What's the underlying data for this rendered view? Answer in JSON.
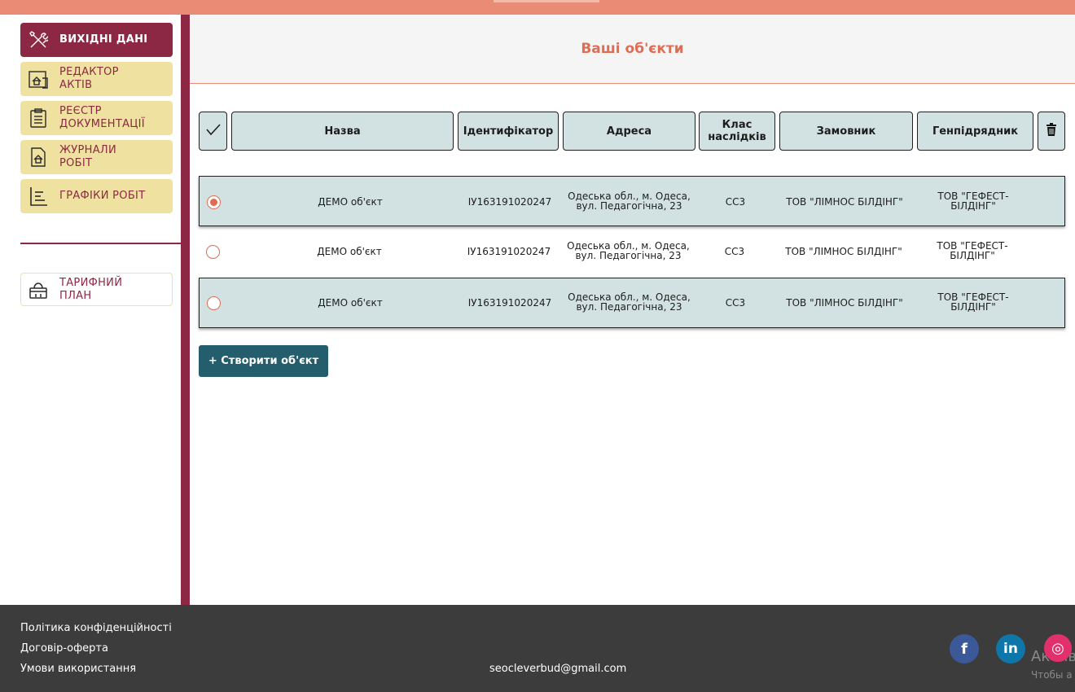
{
  "colors": {
    "accent": "#8c2844",
    "topbar": "#e98b75",
    "title": "#e06c52",
    "nav_bg": "#efe2a0",
    "table_bg": "#d2e2e2",
    "button": "#245d6b",
    "footer": "#3c3c3c"
  },
  "sidebar": {
    "items": [
      {
        "label": "ВИХІДНІ ДАНІ",
        "icon": "tools-icon",
        "active": true
      },
      {
        "label": "РЕДАКТОР АКТІВ",
        "icon": "house-document-icon",
        "active": false
      },
      {
        "label": "РЕЄСТР ДОКУМЕНТАЦІЇ",
        "icon": "clipboard-icon",
        "active": false
      },
      {
        "label": "ЖУРНАЛИ РОБІТ",
        "icon": "house-file-icon",
        "active": false
      },
      {
        "label": "ГРАФІКИ РОБІТ",
        "icon": "chart-lines-icon",
        "active": false
      }
    ],
    "tariff": {
      "label": "ТАРИФНИЙ ПЛАН",
      "icon": "basket-icon"
    }
  },
  "main": {
    "title": "Ваші об'єкти",
    "columns": [
      "Назва",
      "Ідентифікатор",
      "Адреса",
      "Клас наслідків",
      "Замовник",
      "Генпідрядник"
    ],
    "select_all_icon": "checkmark-icon",
    "delete_icon": "trash-icon",
    "rows": [
      {
        "selected": true,
        "name": "ДЕМО об'єкт",
        "id": "ІУ163191020247",
        "address": "Одеська обл., м. Одеса, вул. Педагогічна, 23",
        "class": "СС3",
        "customer": "ТОВ \"ЛІМНОС БІЛДІНГ\"",
        "contractor": "ТОВ \"ГЕФЕСТ-БІЛДІНГ\""
      },
      {
        "selected": false,
        "name": "ДЕМО об'єкт",
        "id": "ІУ163191020247",
        "address": "Одеська обл., м. Одеса, вул. Педагогічна, 23",
        "class": "СС3",
        "customer": "ТОВ \"ЛІМНОС БІЛДІНГ\"",
        "contractor": "ТОВ \"ГЕФЕСТ-БІЛДІНГ\""
      },
      {
        "selected": false,
        "name": "ДЕМО об'єкт",
        "id": "ІУ163191020247",
        "address": "Одеська обл., м. Одеса, вул. Педагогічна, 23",
        "class": "СС3",
        "customer": "ТОВ \"ЛІМНОС БІЛДІНГ\"",
        "contractor": "ТОВ \"ГЕФЕСТ-БІЛДІНГ\""
      }
    ],
    "create_button": "+ Створити об'єкт"
  },
  "footer": {
    "links": [
      "Політика конфіденційності",
      "Договір-оферта",
      "Умови використання"
    ],
    "email": "seocleverbud@gmail.com",
    "social": [
      {
        "name": "facebook-icon",
        "glyph": "f",
        "color": "#3b5998"
      },
      {
        "name": "linkedin-icon",
        "glyph": "in",
        "color": "#0e76a8"
      },
      {
        "name": "instagram-icon",
        "glyph": "◎",
        "color": "#e1306c"
      }
    ],
    "watermark_line1": "Актив",
    "watermark_line2": "Чтобы а"
  }
}
